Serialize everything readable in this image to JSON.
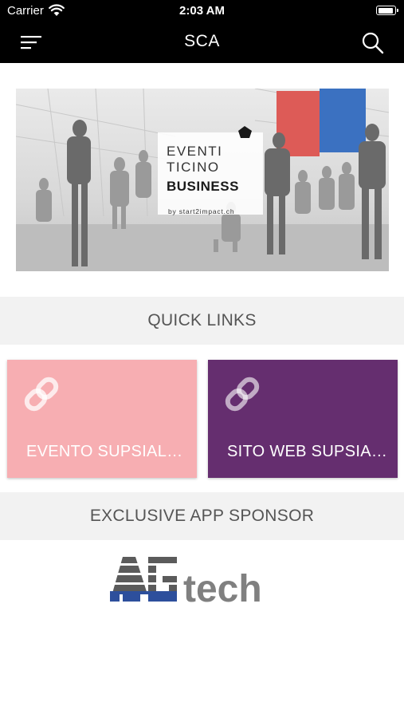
{
  "status_bar": {
    "carrier": "Carrier",
    "time": "2:03 AM"
  },
  "nav": {
    "title": "SCA"
  },
  "banner": {
    "line1": "EVENTI",
    "line2": "TICINO",
    "line3": "BUSINESS",
    "byline": "by start2impact.ch"
  },
  "quick_links": {
    "header": "QUICK LINKS",
    "items": [
      {
        "label": "EVENTO SUPSIAL…",
        "color": "#f7aeb2",
        "icon": "link-icon"
      },
      {
        "label": "SITO WEB SUPSIA…",
        "color": "#652e6f",
        "icon": "link-icon"
      }
    ]
  },
  "sponsor": {
    "header": "EXCLUSIVE APP SPONSOR",
    "logo_text": "AGtech"
  }
}
